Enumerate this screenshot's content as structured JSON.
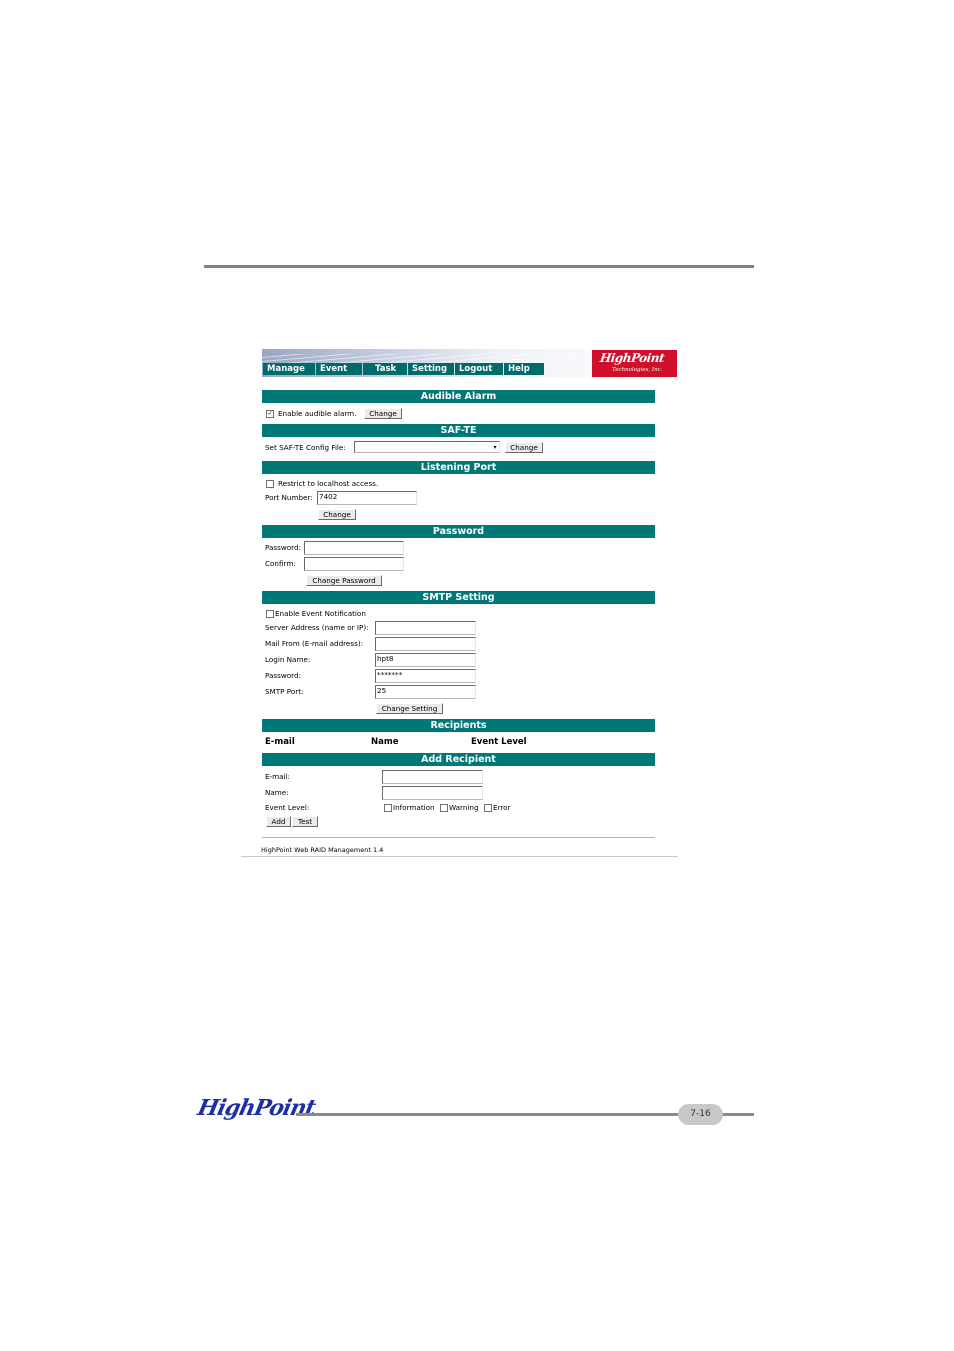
{
  "nav": {
    "items": [
      "Manage",
      "Event",
      "Task",
      "Setting",
      "Logout",
      "Help"
    ]
  },
  "logo": {
    "brand": "HighPoint",
    "sub": "Technologies, Inc."
  },
  "audible_alarm": {
    "title": "Audible Alarm",
    "checkbox_label": "Enable audible alarm.",
    "checked": "✓",
    "button": "Change"
  },
  "safte": {
    "title": "SAF-TE",
    "label": "Set SAF-TE Config File:",
    "select_value": "",
    "button": "Change"
  },
  "listening_port": {
    "title": "Listening Port",
    "checkbox_label": "Restrict to localhost access.",
    "port_label": "Port Number:",
    "port_value": "7402",
    "button": "Change"
  },
  "password": {
    "title": "Password",
    "password_label": "Password:",
    "confirm_label": "Confirm:",
    "button": "Change Password"
  },
  "smtp": {
    "title": "SMTP Setting",
    "enable_label": "Enable Event Notification",
    "server_label": "Server Address (name or IP):",
    "server_value": "",
    "mail_from_label": "Mail From (E-mail address):",
    "mail_from_value": "",
    "login_label": "Login Name:",
    "login_value": "hpt8",
    "password_label": "Password:",
    "password_value": "*******",
    "port_label": "SMTP Port:",
    "port_value": "25",
    "button": "Change Setting"
  },
  "recipients": {
    "title": "Recipients",
    "columns": [
      "E-mail",
      "Name",
      "Event Level"
    ]
  },
  "add_recipient": {
    "title": "Add Recipient",
    "email_label": "E-mail:",
    "name_label": "Name:",
    "level_label": "Event Level:",
    "levels": [
      "Information",
      "Warning",
      "Error"
    ],
    "add_button": "Add",
    "test_button": "Test"
  },
  "app_footer": "HighPoint Web RAID Management 1.4",
  "page": {
    "logo": "HighPoint",
    "number": "7-16"
  }
}
